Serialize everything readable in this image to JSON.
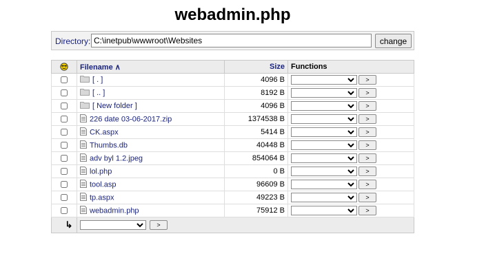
{
  "title": "webadmin.php",
  "directory": {
    "label": "Directory:",
    "value": "C:\\inetpub\\wwwroot\\Websites",
    "change_label": "change"
  },
  "table": {
    "col_icon_name": "smiley-icon",
    "col_filename": "Filename ∧",
    "col_size": "Size",
    "col_functions": "Functions",
    "rows": [
      {
        "name": "[ . ]",
        "size": "4096 B",
        "type": "folder"
      },
      {
        "name": "[ .. ]",
        "size": "8192 B",
        "type": "folder"
      },
      {
        "name": "[ New folder ]",
        "size": "4096 B",
        "type": "folder"
      },
      {
        "name": "226 date 03-06-2017.zip",
        "size": "1374538 B",
        "type": "file"
      },
      {
        "name": "CK.aspx",
        "size": "5414 B",
        "type": "file"
      },
      {
        "name": "Thumbs.db",
        "size": "40448 B",
        "type": "file"
      },
      {
        "name": "adv byl 1.2.jpeg",
        "size": "854064 B",
        "type": "file"
      },
      {
        "name": "lol.php",
        "size": "0 B",
        "type": "file"
      },
      {
        "name": "tool.asp",
        "size": "96609 B",
        "type": "file"
      },
      {
        "name": "tp.aspx",
        "size": "49223 B",
        "type": "file"
      },
      {
        "name": "webadmin.php",
        "size": "75912 B",
        "type": "file"
      }
    ],
    "go_label": ">",
    "footer_arrow": "↳"
  }
}
